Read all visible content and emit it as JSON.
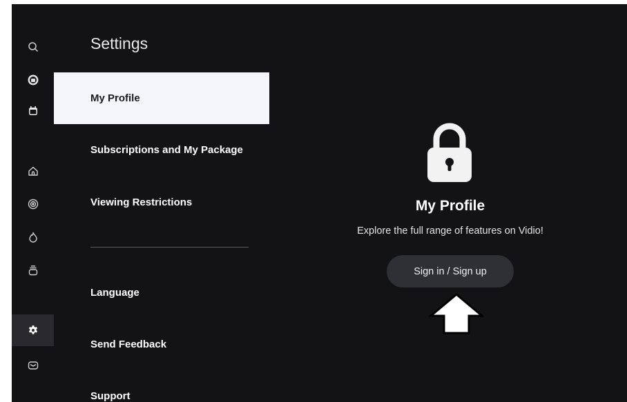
{
  "sidebar": {
    "icons": [
      {
        "name": "search-icon"
      },
      {
        "name": "profile-circle-icon"
      },
      {
        "name": "calendar-icon"
      },
      {
        "name": "home-icon"
      },
      {
        "name": "live-broadcast-icon"
      },
      {
        "name": "trending-flame-icon"
      },
      {
        "name": "library-stack-icon"
      },
      {
        "name": "settings-gear-icon",
        "active": true
      },
      {
        "name": "mail-icon"
      }
    ]
  },
  "settings": {
    "title": "Settings",
    "items": [
      {
        "label": "My Profile",
        "selected": true
      },
      {
        "label": "Subscriptions and My Package"
      },
      {
        "label": "Viewing Restrictions"
      },
      {
        "label": "Language"
      },
      {
        "label": "Send Feedback"
      },
      {
        "label": "Support"
      }
    ]
  },
  "profile_panel": {
    "icon": "lock-icon",
    "title": "My Profile",
    "subtitle": "Explore the full range of features on Vidio!",
    "signin_label": "Sign in / Sign up",
    "pointer": "arrow-up-icon"
  },
  "colors": {
    "background": "#131316",
    "selected_item": "#f3f5fb",
    "button": "#2f3036"
  }
}
